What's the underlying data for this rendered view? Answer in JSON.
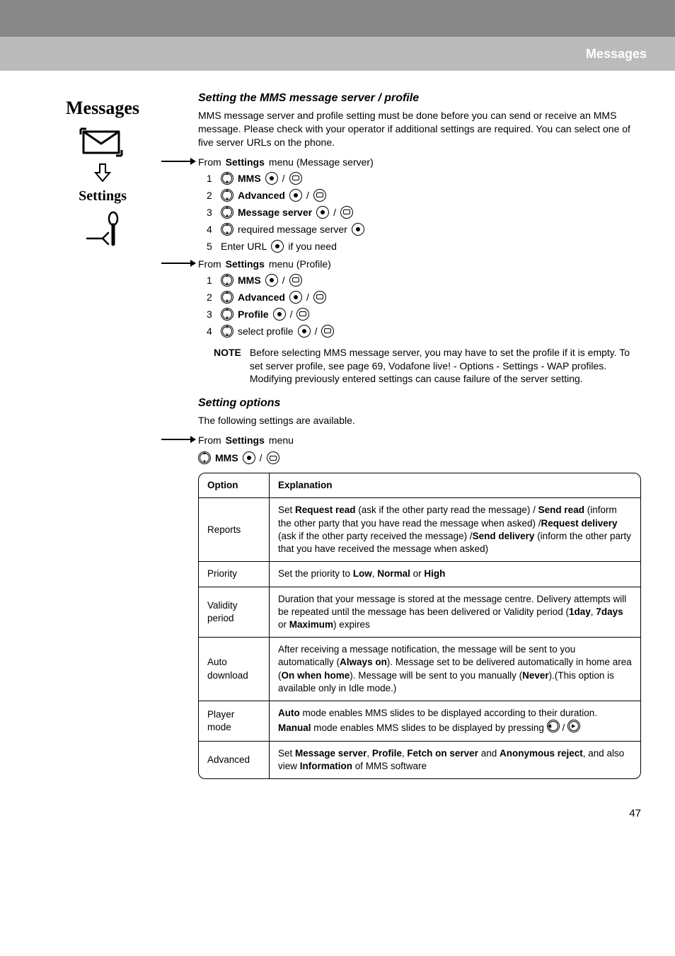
{
  "header": {
    "breadcrumb": "Messages"
  },
  "sidebar": {
    "title": "Messages",
    "subtitle": "Settings"
  },
  "section1": {
    "heading": "Setting the MMS message server / profile",
    "intro": "MMS message server and profile setting must be done before you can send or receive an MMS message. Please check with your operator if additional settings are required. You can select one of five server URLs on the phone.",
    "from1_prefix": "From ",
    "from1_bold": "Settings",
    "from1_suffix": " menu (Message server)",
    "steps1": {
      "s1": "MMS",
      "s2": "Advanced",
      "s3": "Message server",
      "s4": "required message server",
      "s5a": "Enter URL",
      "s5b": "if you need"
    },
    "from2_prefix": "From ",
    "from2_bold": "Settings",
    "from2_suffix": " menu (Profile)",
    "steps2": {
      "s1": "MMS",
      "s2": "Advanced",
      "s3": "Profile",
      "s4": "select profile"
    },
    "note_label": "NOTE",
    "note_text1": "Before selecting MMS message server, you may have to set the profile if it is empty. To set server profile, see page 69, Vodafone live! - Options - Settings - WAP profiles.",
    "note_text2": "Modifying previously entered settings can cause failure of the server setting."
  },
  "section2": {
    "heading": "Setting options",
    "intro": "The following settings are available.",
    "from_prefix": "From ",
    "from_bold": "Settings",
    "from_suffix": " menu",
    "nav_label": "MMS"
  },
  "table": {
    "h1": "Option",
    "h2": "Explanation",
    "rows": [
      {
        "opt": "Reports",
        "parts": [
          "Set ",
          "Request read",
          " (ask if the other party read the message) / ",
          "Send read",
          " (inform the other party that you have read the message when asked) /",
          "Request delivery",
          " (ask if the other party received the message) /",
          "Send delivery",
          " (inform the other party that you have received the message when asked)"
        ]
      },
      {
        "opt": "Priority",
        "parts": [
          "Set the priority to ",
          "Low",
          ", ",
          "Normal",
          " or ",
          "High"
        ]
      },
      {
        "opt": "Validity period",
        "parts": [
          "Duration that your message is stored at the message centre. Delivery attempts will be repeated until the message has been delivered or Validity period (",
          "1day",
          ", ",
          "7days",
          " or ",
          "Maximum",
          ") expires"
        ]
      },
      {
        "opt": "Auto download",
        "parts": [
          "After receiving a message notification, the message will be sent to you automatically (",
          "Always on",
          "). Message set to be delivered automatically in home area (",
          "On when home",
          "). Message will be sent to you manually (",
          "Never",
          ").(This option is available only in Idle mode.)"
        ]
      },
      {
        "opt": "Player mode",
        "parts": [
          "",
          "Auto",
          " mode enables MMS slides to be displayed according to their duration. ",
          "Manual",
          " mode enables MMS slides to be displayed by pressing "
        ]
      },
      {
        "opt": "Advanced",
        "parts": [
          "Set ",
          "Message server",
          ", ",
          "Profile",
          ", ",
          "Fetch on server",
          " and ",
          "Anonymous reject",
          ", and also view ",
          "Information",
          " of MMS software"
        ]
      }
    ]
  },
  "page_number": "47"
}
